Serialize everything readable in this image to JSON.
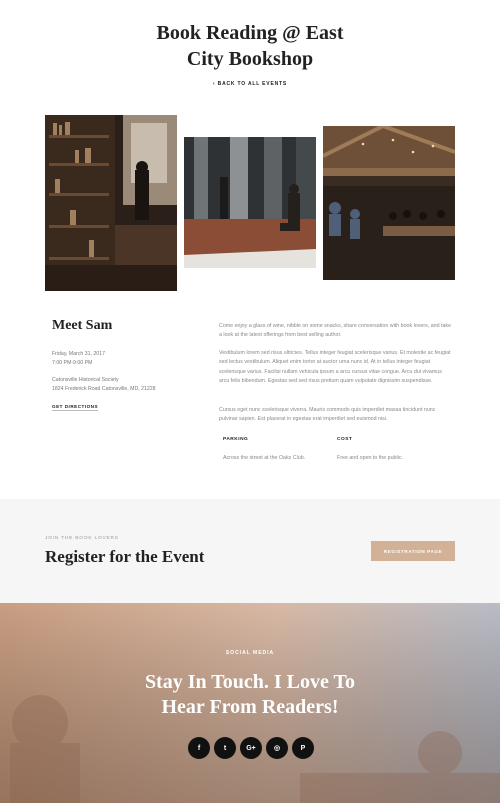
{
  "event": {
    "title_line1": "Book Reading @ East",
    "title_line2": "City Bookshop",
    "back_link": "‹ BACK TO ALL EVENTS"
  },
  "details": {
    "host": "Meet Sam",
    "date": "Friday, March 31, 2017",
    "time": "7:00 PM-9:00 PM",
    "venue": "Catonsville Historical Society",
    "address": "1824 Frederick Road Catonsville, MD, 21228",
    "directions_label": "GET DIRECTIONS"
  },
  "description": {
    "p1": "Come enjoy a glass of wine, nibble on some snacks, share conversation with book lovers, and take a look at the latest offerings from best selling author.",
    "p2": "Vestibulum lorem sed risus ultricies. Tellus integer feugiat scelerisque varius. Et molestie ac feugiat sed lectus vestibulum. Aliquet enim tortor at auctor urna nunc id. At in tellus integer feugiat scelerisque varius. Facilisi nullam vehicula ipsum a arcu cursus vitae congue. Arcu dui vivamus arcu felis bibendum. Egestas sed sed risus pretium quam vulputate dignissim suspendisse.",
    "p3": "Cursus eget nunc scelerisque viverra. Mauris commodo quis imperdiet massa tincidunt nunc pulvinar sapien. Est placerat in egestas erat imperdiet sed euismod nisi."
  },
  "info": {
    "parking_label": "PARKING",
    "parking_value": "Across the street at the Oaks Club.",
    "cost_label": "COST",
    "cost_value": "Free and open to the public."
  },
  "register": {
    "kicker": "JOIN THE BOOK LOVERS",
    "title": "Register for the Event",
    "button": "REGISTRATION PAGE",
    "button_color": "#d2b196"
  },
  "social": {
    "kicker": "SOCIAL MEDIA",
    "title_line1": "Stay In Touch. I Love To",
    "title_line2": "Hear From Readers!",
    "icons": [
      {
        "name": "facebook-icon",
        "glyph": "f"
      },
      {
        "name": "twitter-icon",
        "glyph": "t"
      },
      {
        "name": "google-plus-icon",
        "glyph": "G+"
      },
      {
        "name": "instagram-icon",
        "glyph": "◎"
      },
      {
        "name": "pinterest-icon",
        "glyph": "P"
      }
    ]
  }
}
